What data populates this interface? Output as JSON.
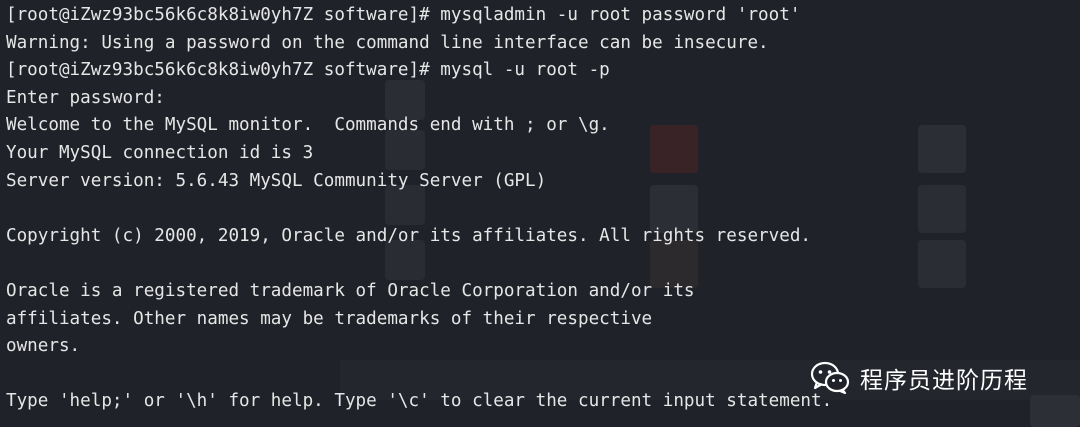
{
  "terminal": {
    "lines": [
      "[root@iZwz93bc56k6c8k8iw0yh7Z software]# mysqladmin -u root password 'root'",
      "Warning: Using a password on the command line interface can be insecure.",
      "[root@iZwz93bc56k6c8k8iw0yh7Z software]# mysql -u root -p",
      "Enter password:",
      "Welcome to the MySQL monitor.  Commands end with ; or \\g.",
      "Your MySQL connection id is 3",
      "Server version: 5.6.43 MySQL Community Server (GPL)",
      "",
      "Copyright (c) 2000, 2019, Oracle and/or its affiliates. All rights reserved.",
      "",
      "Oracle is a registered trademark of Oracle Corporation and/or its",
      "affiliates. Other names may be trademarks of their respective",
      "owners.",
      "",
      "Type 'help;' or '\\h' for help. Type '\\c' to clear the current input statement."
    ]
  },
  "watermark": {
    "icon": "wechat-icon",
    "text": "程序员进阶历程"
  },
  "colors": {
    "background": "#1f2228",
    "text": "#e6e6e6",
    "watermark": "#ffffff"
  }
}
